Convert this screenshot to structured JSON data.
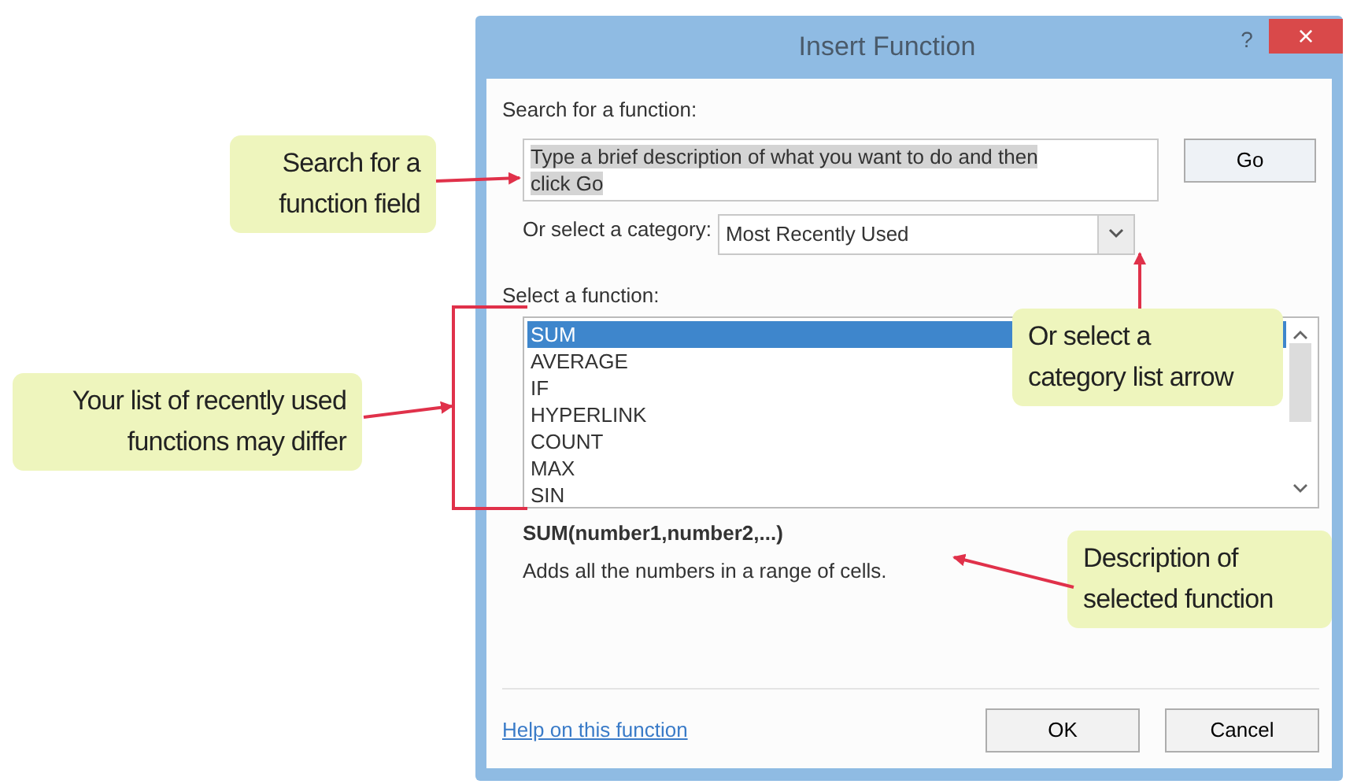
{
  "dialog": {
    "title": "Insert Function",
    "help_button": "?",
    "close_button": "×",
    "search_label": "Search for a function:",
    "search_field": {
      "value": "Type a brief description of what you want to do and then click Go",
      "text_selected": true
    },
    "go_button": "Go",
    "category_label": "Or select a category:",
    "category_select": {
      "value": "Most Recently Used"
    },
    "function_label": "Select a function:",
    "functions": [
      {
        "name": "SUM",
        "selected": true
      },
      {
        "name": "AVERAGE",
        "selected": false
      },
      {
        "name": "IF",
        "selected": false
      },
      {
        "name": "HYPERLINK",
        "selected": false
      },
      {
        "name": "COUNT",
        "selected": false
      },
      {
        "name": "MAX",
        "selected": false
      },
      {
        "name": "SIN",
        "selected": false
      }
    ],
    "signature": "SUM(number1,number2,...)",
    "description": "Adds all the numbers in a range of cells.",
    "help_link": "Help on this function",
    "buttons": [
      "OK",
      "Cancel"
    ]
  },
  "callouts": [
    {
      "lines": [
        "Search for a",
        "function field"
      ]
    },
    {
      "lines": [
        "Your list of recently used",
        "functions may differ"
      ]
    },
    {
      "lines": [
        "Or select a",
        "category list arrow"
      ]
    },
    {
      "lines": [
        "Description of",
        "selected function"
      ]
    }
  ]
}
